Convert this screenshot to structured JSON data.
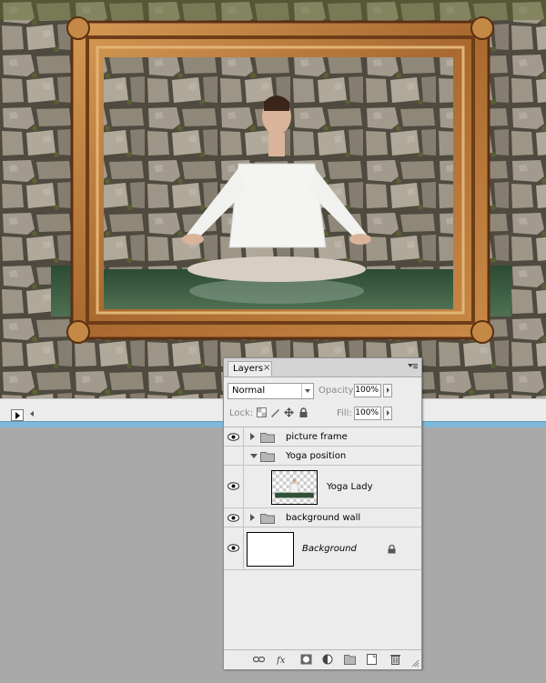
{
  "layers_panel": {
    "tab_label": "Layers",
    "tab_close": "×",
    "blend_mode": "Normal",
    "opacity_label": "Opacity:",
    "opacity_value": "100%",
    "lock_label": "Lock:",
    "fill_label": "Fill:",
    "fill_value": "100%",
    "layers": [
      {
        "name": "picture frame",
        "type": "group",
        "expanded": false
      },
      {
        "name": "Yoga position",
        "type": "group",
        "expanded": true
      },
      {
        "name": "Yoga Lady",
        "type": "layer"
      },
      {
        "name": "background wall",
        "type": "group",
        "expanded": false
      },
      {
        "name": "Background",
        "type": "layer",
        "locked": true
      }
    ]
  },
  "colors": {
    "frame_gold": "#b87a3a",
    "frame_dark": "#6e3d18",
    "stone": "#8d8678",
    "water": "#3d5b42",
    "scroll_accent": "#7fb8d8"
  }
}
